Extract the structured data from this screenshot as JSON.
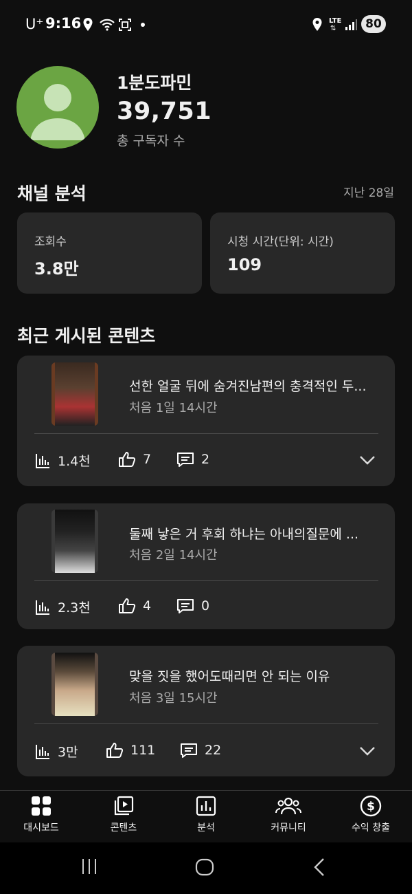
{
  "status_bar": {
    "carrier": "U⁺",
    "time": "9:16",
    "network": "LTE",
    "battery": "80"
  },
  "channel": {
    "name": "1분도파민",
    "subscriber_count": "39,751",
    "subscriber_label": "총 구독자 수"
  },
  "analytics": {
    "title": "채널 분석",
    "period": "지난 28일",
    "views_label": "조회수",
    "views_value": "3.8만",
    "watch_label": "시청 시간(단위: 시간)",
    "watch_value": "109"
  },
  "recent": {
    "title": "최근 게시된 콘텐츠",
    "items": [
      {
        "title": "선한 얼굴 뒤에 숨겨진남편의 충격적인 두...",
        "time": "처음 1일 14시간",
        "views": "1.4천",
        "likes": "7",
        "comments": "2"
      },
      {
        "title": "둘째 낳은 거 후회 하냐는 아내의질문에 ...",
        "time": "처음 2일 14시간",
        "views": "2.3천",
        "likes": "4",
        "comments": "0"
      },
      {
        "title": "맞을 짓을 했어도때리면 안 되는 이유",
        "time": "처음 3일 15시간",
        "views": "3만",
        "likes": "111",
        "comments": "22"
      }
    ]
  },
  "nav": {
    "dashboard": "대시보드",
    "content": "콘텐츠",
    "analytics": "분석",
    "community": "커뮤니티",
    "earn": "수익 창출"
  },
  "colors": {
    "background": "#0f0f0f",
    "card": "#282828",
    "avatar": "#6ba543"
  }
}
